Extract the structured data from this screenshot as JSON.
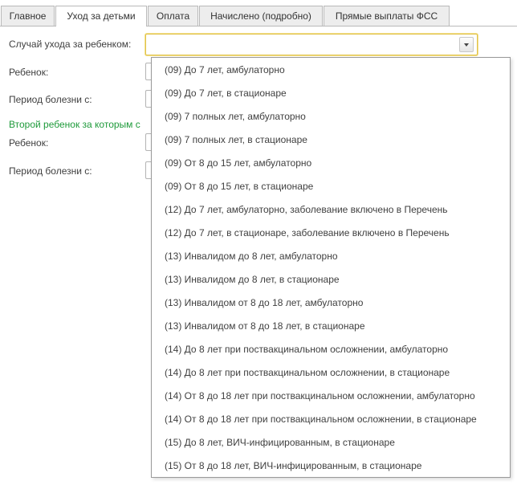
{
  "tabs": [
    {
      "label": "Главное",
      "active": false
    },
    {
      "label": "Уход за детьми",
      "active": true
    },
    {
      "label": "Оплата",
      "active": false
    },
    {
      "label": "Начислено (подробно)",
      "active": false
    },
    {
      "label": "Прямые выплаты ФСС",
      "active": false
    }
  ],
  "form": {
    "case_label": "Случай ухода за ребенком:",
    "case_value": "",
    "child_label": "Ребенок:",
    "period_label": "Период болезни с:",
    "second_child_label": "Второй ребенок за которым с",
    "child2_label": "Ребенок:",
    "period2_label": "Период болезни с:"
  },
  "dropdown": {
    "items": [
      "(09) До 7 лет, амбулаторно",
      "(09) До 7 лет, в стационаре",
      "(09) 7 полных лет, амбулаторно",
      "(09) 7 полных лет, в стационаре",
      "(09) От 8 до 15 лет, амбулаторно",
      "(09) От 8 до 15 лет, в стационаре",
      "(12) До 7 лет, амбулаторно, заболевание включено в Перечень",
      "(12) До 7 лет, в стационаре, заболевание включено в Перечень",
      "(13) Инвалидом до 8 лет, амбулаторно",
      "(13) Инвалидом до 8 лет, в стационаре",
      "(13) Инвалидом от 8 до 18 лет, амбулаторно",
      "(13) Инвалидом от 8 до 18 лет, в стационаре",
      "(14) До 8 лет при поствакцинальном осложнении, амбулаторно",
      "(14) До 8 лет при поствакцинальном осложнении, в стационаре",
      "(14) От 8 до 18 лет при поствакцинальном осложнении, амбулаторно",
      "(14) От 8 до 18 лет при поствакцинальном осложнении, в стационаре",
      "(15) До 8 лет, ВИЧ-инфицированным, в стационаре",
      "(15) От 8 до 18 лет, ВИЧ-инфицированным, в стационаре"
    ]
  },
  "colors": {
    "accent_border": "#e0c24a",
    "green_text": "#1e9a3a"
  }
}
